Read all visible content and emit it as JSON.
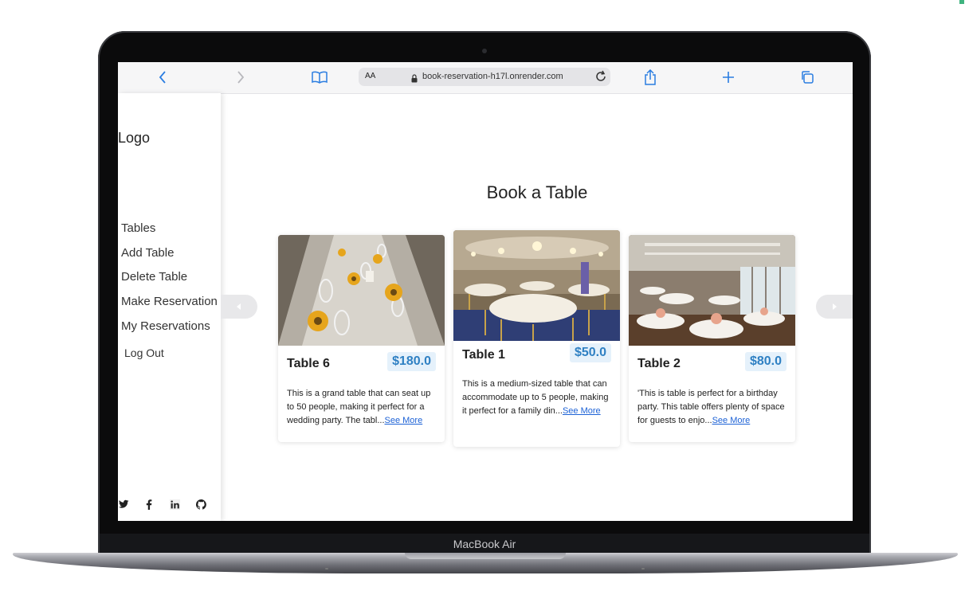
{
  "device": {
    "label": "MacBook Air"
  },
  "browser": {
    "aa_label": "AA",
    "url": "book-reservation-h17l.onrender.com"
  },
  "sidebar": {
    "logo": "Logo",
    "items": [
      {
        "label": "Tables"
      },
      {
        "label": "Add Table"
      },
      {
        "label": "Delete Table"
      },
      {
        "label": "Make Reservation"
      },
      {
        "label": "My Reservations"
      }
    ],
    "logout": "Log Out",
    "social": [
      "twitter-icon",
      "facebook-icon",
      "linkedin-icon",
      "github-icon"
    ]
  },
  "main": {
    "title": "Book a Table",
    "cards": [
      {
        "name": "Table 6",
        "price": "$180.0",
        "description": "This is a grand table that can seat up to 50 people, making it perfect for a wedding party. The tabl...",
        "link": "See More"
      },
      {
        "name": "Table 1",
        "price": "$50.0",
        "description": "This is a medium-sized table that can accommodate up to 5 people, making it perfect for a family din...",
        "link": "See More"
      },
      {
        "name": "Table 2",
        "price": "$80.0",
        "description": "'This is table is perfect for a birthday party. This table offers plenty of space for guests to enjo...",
        "link": "See More"
      }
    ]
  },
  "colors": {
    "accent": "#2f80c3",
    "link": "#1d62d6",
    "price_bg": "#e5f1fb"
  }
}
